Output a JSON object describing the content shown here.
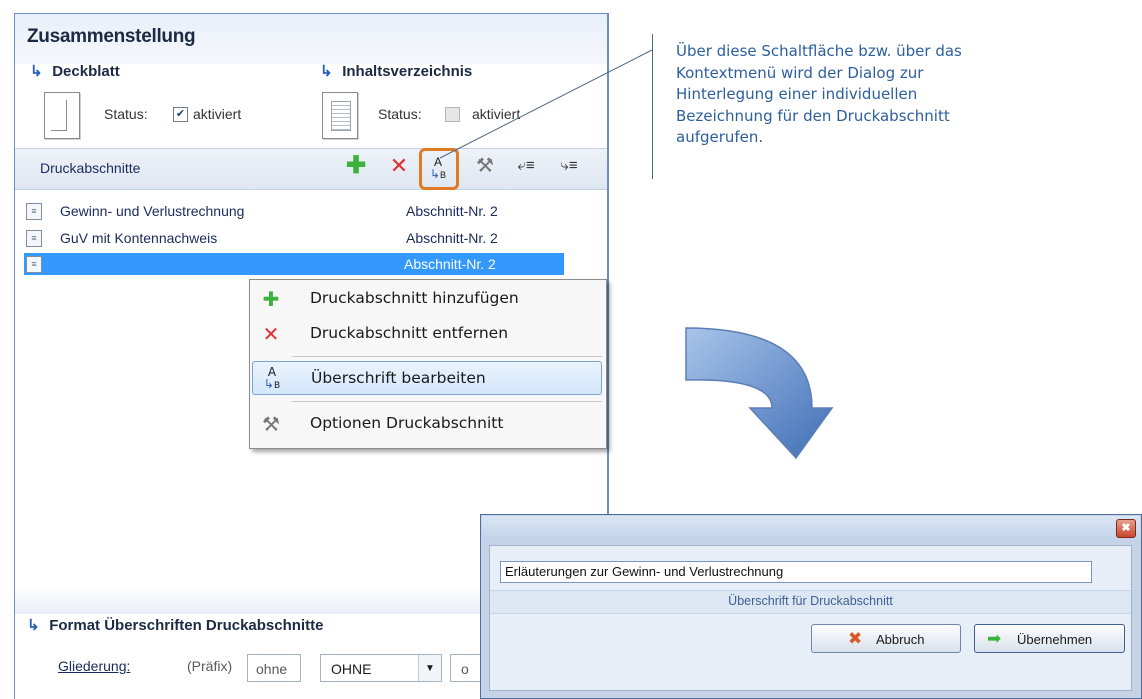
{
  "panel": {
    "title": "Zusammenstellung",
    "deckblatt": {
      "heading": "Deckblatt",
      "status_label": "Status:",
      "checkbox_label": "aktiviert",
      "checked": true
    },
    "inhaltsverzeichnis": {
      "heading": "Inhaltsverzeichnis",
      "status_label": "Status:",
      "checkbox_label": "aktiviert",
      "checked": false
    },
    "druckabschnitte": {
      "label": "Druckabschnitte",
      "toolbar_icons": [
        "add-icon",
        "remove-icon",
        "edit-heading-icon",
        "options-icon",
        "move-up-icon",
        "move-down-icon"
      ]
    },
    "rows": [
      {
        "label": "Gewinn- und Verlustrechnung",
        "value": "Abschnitt-Nr. 2",
        "selected": false
      },
      {
        "label": "GuV mit Kontennachweis",
        "value": "Abschnitt-Nr. 2",
        "selected": false
      },
      {
        "label": "",
        "value": "Abschnitt-Nr. 2",
        "selected": true
      }
    ],
    "format_section": {
      "heading": "Format Überschriften Druckabschnitte",
      "gliederung_label": "Gliederung:",
      "praefix_label": "(Präfix)",
      "praefix_value": "ohne",
      "select_value": "OHNE",
      "partial_value": "o"
    }
  },
  "context_menu": {
    "items": [
      {
        "label": "Druckabschnitt hinzufügen",
        "icon": "add-icon"
      },
      {
        "label": "Druckabschnitt entfernen",
        "icon": "remove-icon"
      },
      {
        "label": "Überschrift bearbeiten",
        "icon": "edit-heading-icon",
        "highlighted": true
      },
      {
        "label": "Optionen Druckabschnitt",
        "icon": "options-icon"
      }
    ]
  },
  "annotation": {
    "text": "Über diese Schaltfläche bzw. über das Kontextmenü wird der Dialog zur Hinterlegung einer individuellen Bezeichnung für den Druckabschnitt aufgerufen."
  },
  "dialog": {
    "input_value": "Erläuterungen zur Gewinn- und Verlustrechnung",
    "caption": "Überschrift für Druckabschnitt",
    "cancel_label": "Abbruch",
    "apply_label": "Übernehmen"
  },
  "colors": {
    "accent": "#2c60b8",
    "selection": "#3399ff",
    "highlight_outline": "#e07b22",
    "annotation_text": "#2c5f9e",
    "arrow_fill": "#4a7cc4"
  }
}
